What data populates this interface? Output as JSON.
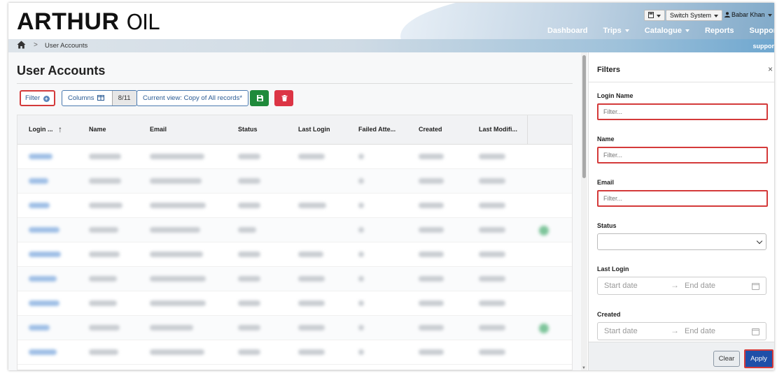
{
  "header": {
    "logo_bold": "ARTHUR",
    "logo_light": "OIL",
    "calculator_icon": "calculator-icon",
    "switch_system": "Switch System",
    "user_name": "Babar Khan"
  },
  "nav": {
    "items": [
      {
        "label": "Dashboard",
        "dropdown": false
      },
      {
        "label": "Trips",
        "dropdown": true
      },
      {
        "label": "Catalogue",
        "dropdown": true
      },
      {
        "label": "Reports",
        "dropdown": false
      },
      {
        "label": "Support",
        "dropdown": true
      }
    ]
  },
  "breadcrumb": {
    "home_icon": "home-icon",
    "separator": ">",
    "current": "User Accounts",
    "right_link": "suppor"
  },
  "page": {
    "title": "User Accounts"
  },
  "toolbar": {
    "filter_label": "Filter",
    "columns_label": "Columns",
    "columns_count": "8/11",
    "current_view": "Current view: Copy of All records*",
    "save_icon": "save-icon",
    "delete_icon": "trash-icon"
  },
  "table": {
    "columns": [
      "Login ...",
      "Name",
      "Email",
      "Status",
      "Last Login",
      "Failed Atte...",
      "Created",
      "Last Modifi..."
    ],
    "sort_indicator": "↑",
    "rows_visible": 9,
    "rows_note_blurred": true
  },
  "filters": {
    "title": "Filters",
    "close": "×",
    "login_name": {
      "label": "Login Name",
      "placeholder": "Filter..."
    },
    "name": {
      "label": "Name",
      "placeholder": "Filter..."
    },
    "email": {
      "label": "Email",
      "placeholder": "Filter..."
    },
    "status": {
      "label": "Status",
      "value": ""
    },
    "last_login": {
      "label": "Last Login",
      "start": "Start date",
      "end": "End date"
    },
    "created": {
      "label": "Created",
      "start": "Start date",
      "end": "End date"
    },
    "clear_label": "Clear",
    "apply_label": "Apply"
  },
  "colors": {
    "accent": "#1f4fa8",
    "highlight_border": "#d43a3a",
    "save_green": "#1f8a3b",
    "delete_red": "#dc3545"
  }
}
